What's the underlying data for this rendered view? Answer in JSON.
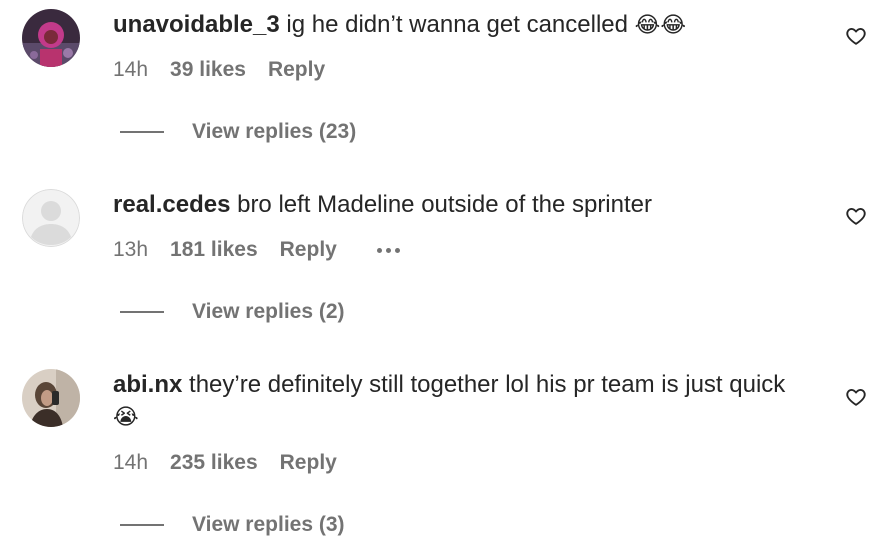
{
  "comments": [
    {
      "username": "unavoidable_3",
      "text": "ig he didn’t wanna get cancelled",
      "emoji": "😂😂",
      "time": "14h",
      "likes": "39 likes",
      "reply": "Reply",
      "view_replies": "View replies (23)",
      "avatar_icon": "profile-photo"
    },
    {
      "username": "real.cedes",
      "text": "bro left Madeline outside of the sprinter",
      "emoji": "",
      "time": "13h",
      "likes": "181 likes",
      "reply": "Reply",
      "more_icon": "ellipsis-icon",
      "view_replies": "View replies (2)",
      "avatar_icon": "default-avatar"
    },
    {
      "username": "abi.nx",
      "text": "they’re definitely still together lol his pr team is just quick",
      "emoji": "😭",
      "time": "14h",
      "likes": "235 likes",
      "reply": "Reply",
      "view_replies": "View replies (3)",
      "avatar_icon": "profile-photo"
    }
  ],
  "colors": {
    "text": "#262626",
    "secondary": "#737373",
    "default_avatar_bg": "#dbdbdb"
  },
  "icons": {
    "like": "heart-outline-icon"
  }
}
